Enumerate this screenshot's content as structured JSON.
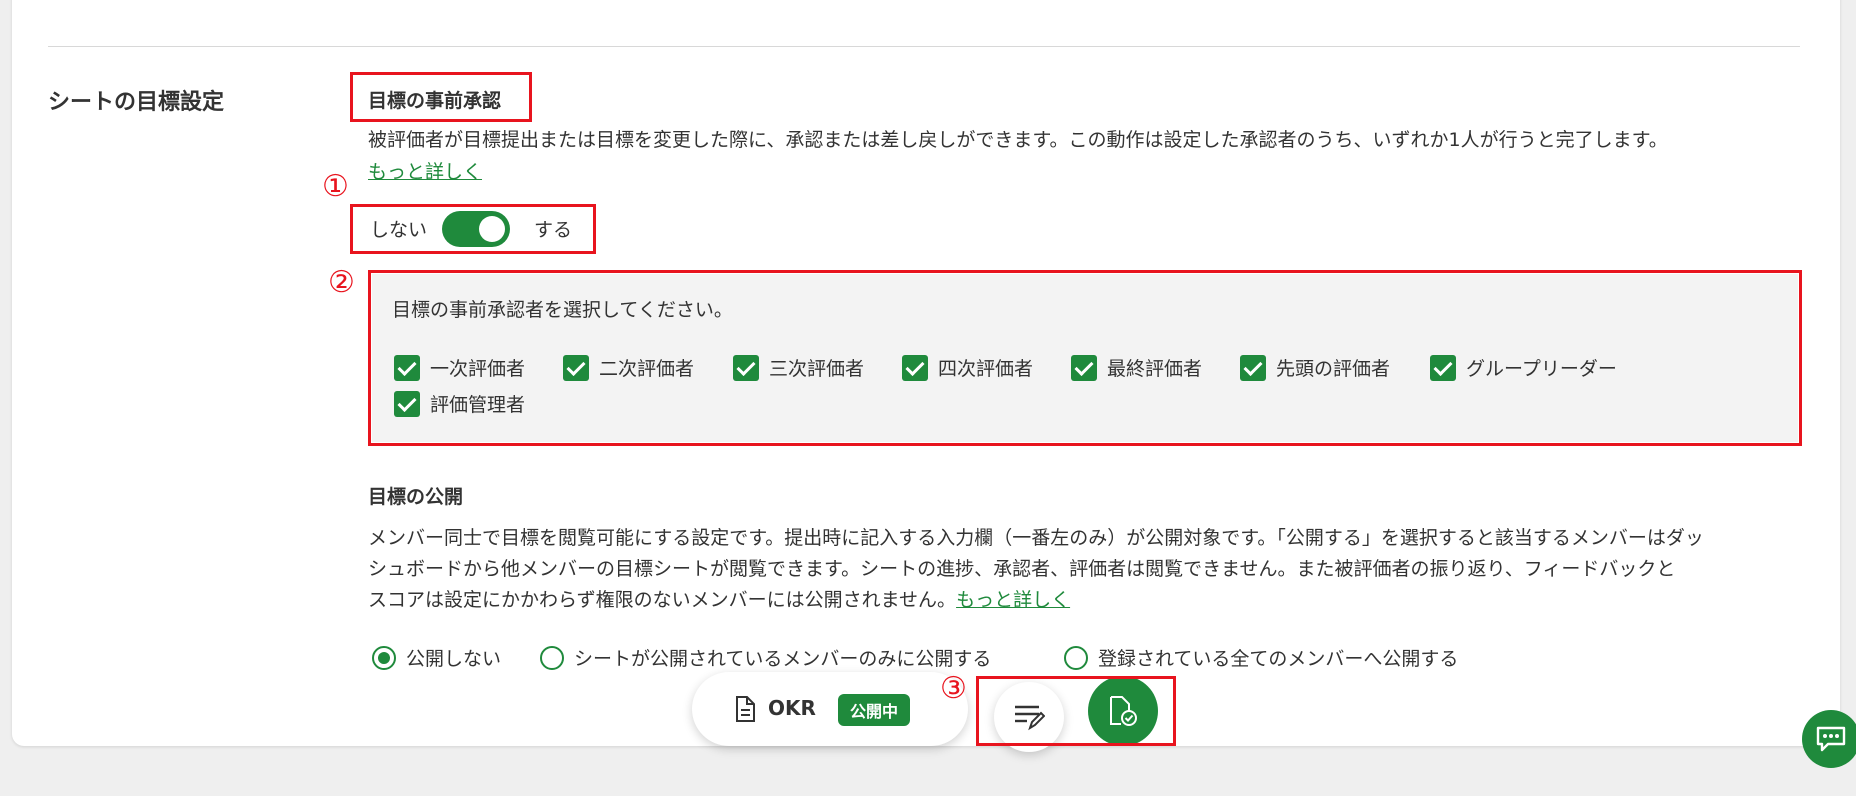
{
  "section": {
    "title": "シートの目標設定"
  },
  "pre_approval": {
    "heading": "目標の事前承認",
    "description": "被評価者が目標提出または目標を変更した際に、承認または差し戻しができます。この動作は設定した承認者のうち、いずれか1人が行うと完了します。",
    "more_link": "もっと詳しく",
    "toggle": {
      "off_label": "しない",
      "on_label": "する",
      "state": "on"
    },
    "approver_prompt": "目標の事前承認者を選択してください。",
    "approvers": [
      {
        "label": "一次評価者",
        "checked": true
      },
      {
        "label": "二次評価者",
        "checked": true
      },
      {
        "label": "三次評価者",
        "checked": true
      },
      {
        "label": "四次評価者",
        "checked": true
      },
      {
        "label": "最終評価者",
        "checked": true
      },
      {
        "label": "先頭の評価者",
        "checked": true
      },
      {
        "label": "グループリーダー",
        "checked": true
      },
      {
        "label": "評価管理者",
        "checked": true
      }
    ]
  },
  "publication": {
    "heading": "目標の公開",
    "desc_line1": "メンバー同士で目標を閲覧可能にする設定です。提出時に記入する入力欄（一番左のみ）が公開対象です。「公開する」を選択すると該当するメンバーはダッ",
    "desc_line2": "シュボードから他メンバーの目標シートが閲覧できます。シートの進捗、承認者、評価者は閲覧できません。また被評価者の振り返り、フィードバックと",
    "desc_line3": "スコアは設定にかかわらず権限のないメンバーには公開されません。",
    "more_link": "もっと詳しく",
    "options": [
      {
        "label": "公開しない",
        "selected": true
      },
      {
        "label": "シートが公開されているメンバーのみに公開する",
        "selected": false
      },
      {
        "label": "登録されている全てのメンバーへ公開する",
        "selected": false
      }
    ]
  },
  "footer": {
    "sheet_name": "OKR",
    "status_badge": "公開中"
  },
  "markers": {
    "m1": "①",
    "m2": "②",
    "m3": "③"
  },
  "colors": {
    "accent": "#1f8a3c",
    "annotation": "#e8141e"
  },
  "icons": [
    "document-icon",
    "edit-list-icon",
    "file-check-icon",
    "chat-icon"
  ]
}
